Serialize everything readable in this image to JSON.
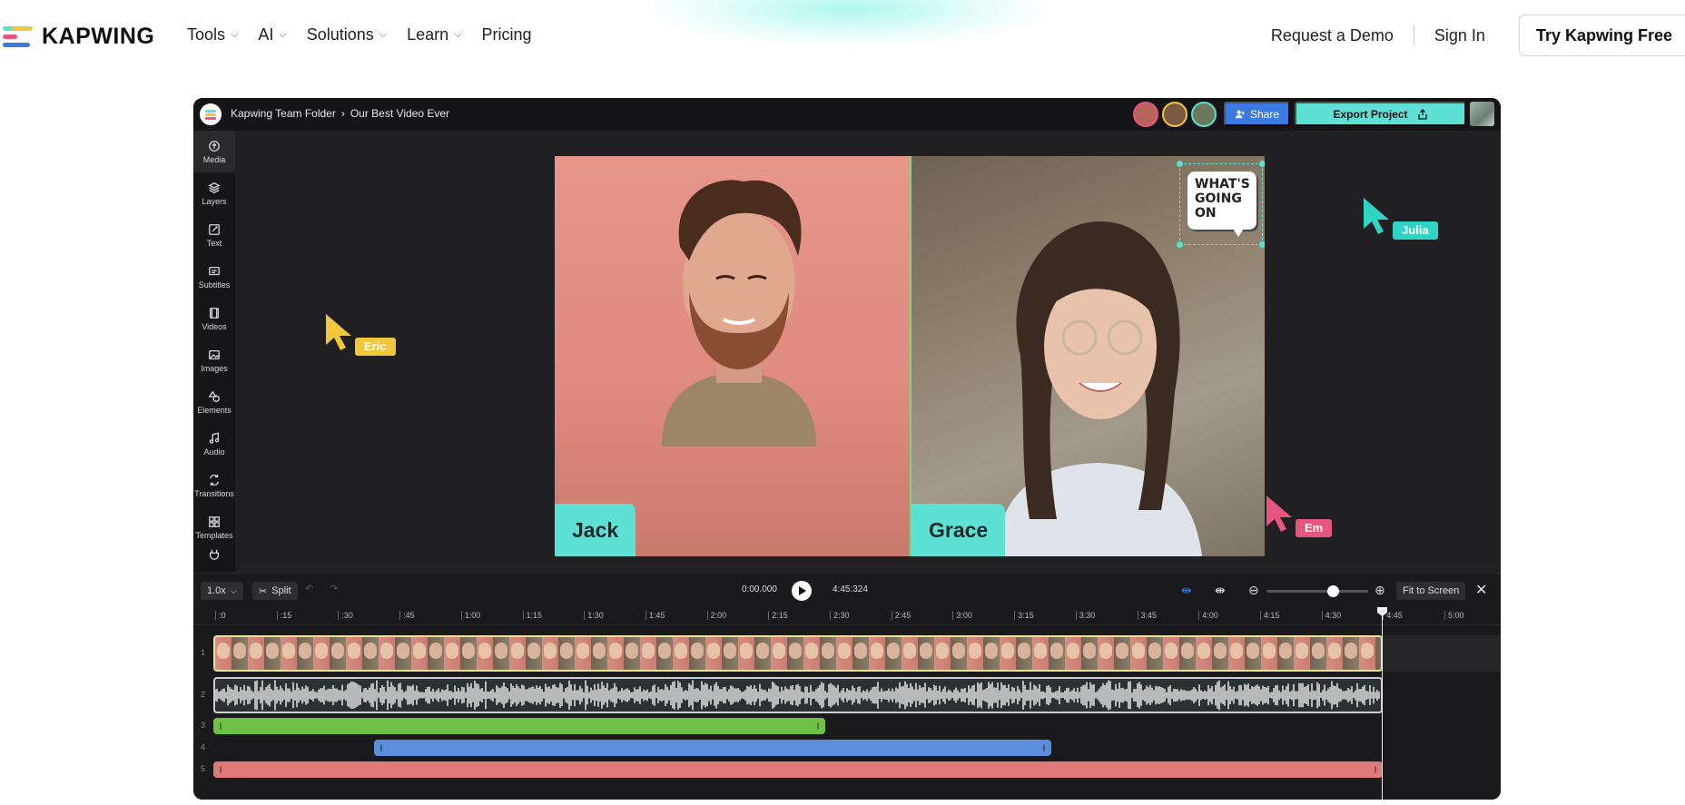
{
  "nav": {
    "brand": "KAPWING",
    "brand_colors": [
      "#f0c63c",
      "#5ee0d4",
      "#e6567f",
      "#3b7ae0"
    ],
    "menu": [
      {
        "label": "Tools",
        "has_dropdown": true
      },
      {
        "label": "AI",
        "has_dropdown": true
      },
      {
        "label": "Solutions",
        "has_dropdown": true
      },
      {
        "label": "Learn",
        "has_dropdown": true
      },
      {
        "label": "Pricing",
        "has_dropdown": false
      }
    ],
    "request_demo": "Request a Demo",
    "sign_in": "Sign In",
    "cta": "Try Kapwing Free"
  },
  "editor": {
    "breadcrumb": {
      "folder": "Kapwing Team Folder",
      "separator": "›",
      "project": "Our Best Video Ever"
    },
    "share_label": "Share",
    "export_label": "Export Project",
    "collaborators": [
      {
        "initial": "",
        "ring": "#e6567f",
        "fill": "#b8645a"
      },
      {
        "initial": "",
        "ring": "#f0c63c",
        "fill": "#7a5a44"
      },
      {
        "initial": "",
        "ring": "#5ee0d4",
        "fill": "#6a7a5a"
      }
    ],
    "sidebar": [
      {
        "label": "Media",
        "icon": "upload-icon",
        "active": true
      },
      {
        "label": "Layers",
        "icon": "layers-icon",
        "active": false
      },
      {
        "label": "Text",
        "icon": "text-icon",
        "active": false
      },
      {
        "label": "Subtitles",
        "icon": "subtitles-icon",
        "active": false
      },
      {
        "label": "Videos",
        "icon": "film-icon",
        "active": false
      },
      {
        "label": "Images",
        "icon": "image-icon",
        "active": false
      },
      {
        "label": "Elements",
        "icon": "shapes-icon",
        "active": false
      },
      {
        "label": "Audio",
        "icon": "music-icon",
        "active": false
      },
      {
        "label": "Transitions",
        "icon": "transition-icon",
        "active": false
      },
      {
        "label": "Templates",
        "icon": "grid-icon",
        "active": false
      }
    ],
    "canvas": {
      "left_name": "Jack",
      "right_name": "Grace",
      "sticker_text": "WHAT'S GOING ON",
      "accent": "#5ee0d4"
    },
    "cursors": [
      {
        "name": "Eric",
        "color": "#f0c63c"
      },
      {
        "name": "Julia",
        "color": "#2fd4c4"
      },
      {
        "name": "Em",
        "color": "#e6567f"
      }
    ],
    "timeline": {
      "speed": "1.0x",
      "split_label": "Split",
      "current_time": "0:00.000",
      "total_time": "4:45:324",
      "fit_label": "Fit to Screen",
      "zoom_level": 0.65,
      "ticks": [
        ":0",
        ":15",
        ":30",
        ":45",
        "1:00",
        "1:15",
        "1:30",
        "1:45",
        "2:00",
        "2:15",
        "2:30",
        "2:45",
        "3:00",
        "3:15",
        "3:30",
        "3:45",
        "4:00",
        "4:15",
        "4:30",
        "4:45",
        "5:00"
      ],
      "track_numbers": [
        "1",
        "2",
        "3",
        "4",
        "5"
      ],
      "bars": [
        {
          "track": "3",
          "color": "#6fc146"
        },
        {
          "track": "4",
          "color": "#5b8fdc"
        },
        {
          "track": "5",
          "color": "#e07a78"
        }
      ]
    }
  }
}
